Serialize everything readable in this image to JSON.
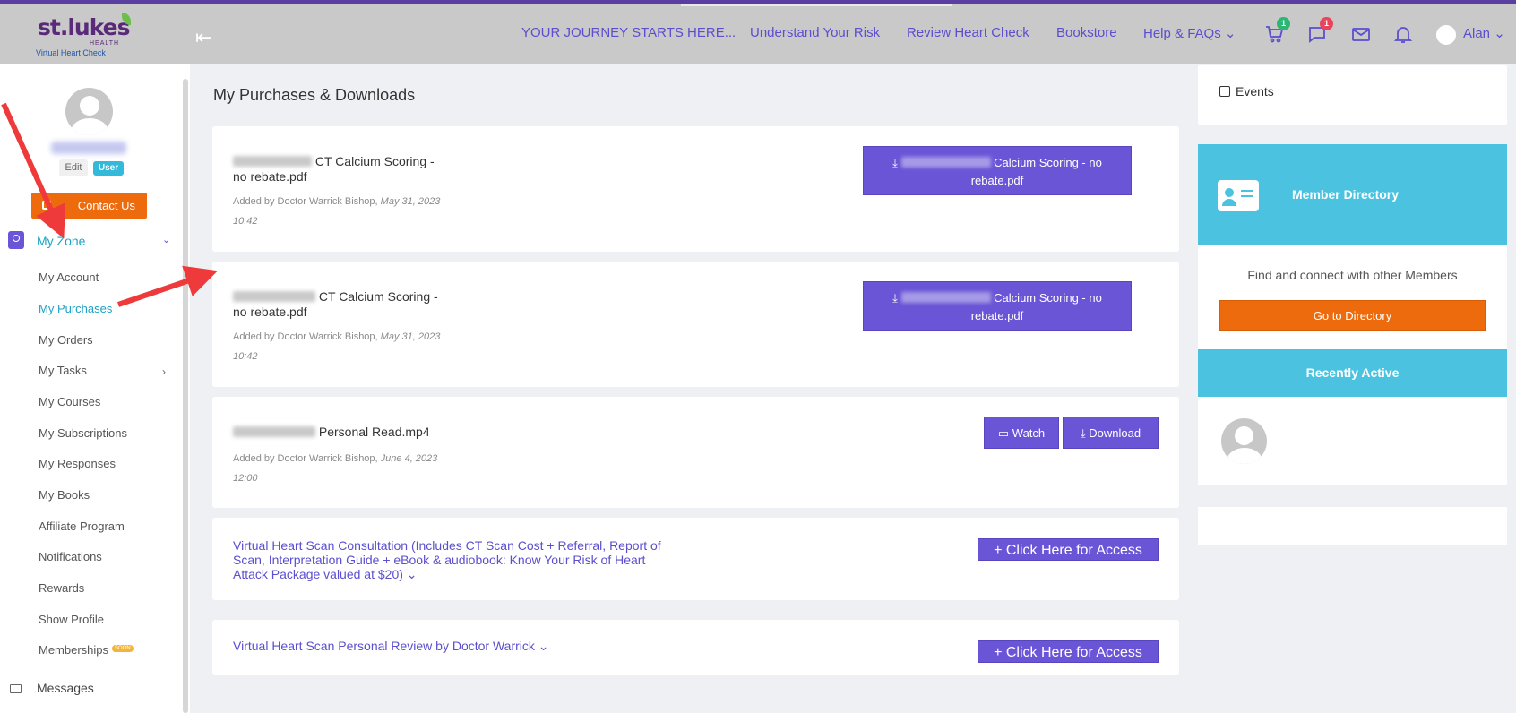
{
  "header": {
    "logo_brand": "st.lukes",
    "logo_health": "HEALTH",
    "logo_product": "Virtual Heart Check",
    "nav": {
      "journey": "YOUR JOURNEY STARTS HERE...",
      "risk": "Understand Your Risk",
      "review": "Review Heart Check",
      "bookstore": "Bookstore",
      "help": "Help & FAQs ⌄"
    },
    "cart_count": "1",
    "messages_count": "1",
    "user_name": "Alan ⌄"
  },
  "sidebar": {
    "edit_label": "Edit",
    "role_tag": "User",
    "contact_label": "Contact Us",
    "section_label": "My Zone",
    "items": [
      "My Account",
      "My Purchases",
      "My Orders",
      "My Tasks",
      "My Courses",
      "My Subscriptions",
      "My Responses",
      "My Books",
      "Affiliate Program",
      "Notifications",
      "Rewards",
      "Show Profile",
      "Memberships"
    ],
    "soon_tag": "SOON",
    "messages_label": "Messages"
  },
  "main": {
    "title": "My Purchases & Downloads",
    "files": [
      {
        "name_line1": "CT Calcium Scoring -",
        "name_line2": "no rebate.pdf",
        "added_by": "Added by Doctor Warrick Bishop,",
        "date": "May 31, 2023",
        "time": "10:42",
        "button_line1": "Calcium Scoring - no",
        "button_line2": "rebate.pdf"
      },
      {
        "name_line1": "CT Calcium Scoring -",
        "name_line2": "no rebate.pdf",
        "added_by": "Added by Doctor Warrick Bishop,",
        "date": "May 31, 2023",
        "time": "10:42",
        "button_line1": "Calcium Scoring - no",
        "button_line2": "rebate.pdf"
      },
      {
        "name_line1": "Personal Read.mp4",
        "added_by": "Added by Doctor Warrick Bishop,",
        "date": "June 4, 2023",
        "time": "12:00",
        "watch_label": "Watch",
        "download_label": "Download"
      }
    ],
    "access_items": [
      {
        "line1": "Virtual Heart Scan Consultation (Includes CT Scan Cost + Referral, Report of",
        "line2": "Scan, Interpretation Guide  + eBook & audiobook: Know Your Risk of Heart",
        "line3": "Attack Package valued at $20) ⌄",
        "button": "+ Click Here for Access"
      },
      {
        "line1": "Virtual Heart Scan Personal Review by Doctor Warrick ⌄",
        "button": "+ Click Here for Access"
      }
    ]
  },
  "right": {
    "events_label": "Events",
    "member_directory_title": "Member Directory",
    "member_directory_sub": "Find and connect with other Members",
    "directory_button": "Go to Directory",
    "recently_active_title": "Recently Active"
  },
  "colors": {
    "accent": "#6a55d6",
    "orange": "#ee6b0d",
    "cyan": "#4bc3e0",
    "annotation_arrow": "#ee3a3a"
  }
}
